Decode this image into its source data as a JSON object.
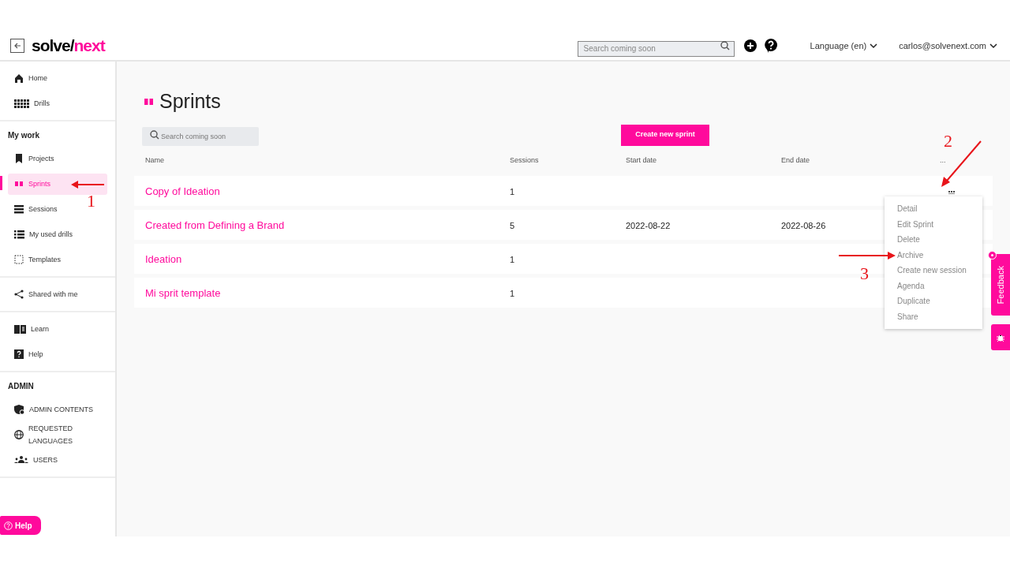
{
  "header": {
    "logo": {
      "text": "solve/",
      "accent": "next"
    },
    "search": {
      "placeholder": "Search coming soon"
    },
    "language": "Language (en)",
    "user": "carlos@solvenext.com"
  },
  "sidebar": {
    "sections": [
      {
        "items": [
          {
            "label": "Home",
            "selected": false
          },
          {
            "label": "Drills",
            "selected": false
          }
        ]
      },
      {
        "heading": "My work",
        "items": [
          {
            "label": "Projects",
            "selected": false
          },
          {
            "label": "Sprints",
            "selected": true
          },
          {
            "label": "Sessions",
            "selected": false
          },
          {
            "label": "My used drills",
            "selected": false
          },
          {
            "label": "Templates",
            "selected": false
          }
        ]
      },
      {
        "items": [
          {
            "label": "Shared with me",
            "selected": false
          }
        ]
      },
      {
        "items": [
          {
            "label": "Learn",
            "selected": false
          },
          {
            "label": "Help",
            "selected": false
          }
        ]
      },
      {
        "heading": "ADMIN",
        "items": [
          {
            "label": "ADMIN CONTENTS",
            "selected": false
          },
          {
            "label": "REQUESTED LANGUAGES",
            "selected": false
          },
          {
            "label": "USERS",
            "selected": false
          }
        ]
      }
    ],
    "help_button": "Help"
  },
  "page": {
    "title": "Sprints",
    "search": {
      "placeholder": "Search coming soon"
    },
    "create_button": "Create new sprint"
  },
  "table": {
    "columns": [
      "Name",
      "Sessions",
      "Start date",
      "End date",
      "..."
    ],
    "rows": [
      {
        "name": "Copy of Ideation",
        "sessions": "1",
        "menu_open": true
      },
      {
        "name": "Created from Defining a Brand",
        "sessions": "5",
        "start_date": "2022-08-22",
        "end_date": "2022-08-26",
        "menu_open": false
      },
      {
        "name": "Ideation",
        "sessions": "1",
        "menu_open": false
      },
      {
        "name": "Mi sprit template",
        "sessions": "1",
        "menu_open": false
      }
    ]
  },
  "row_menu": {
    "items": [
      "Detail",
      "Edit Sprint",
      "Delete",
      "Archive",
      "Create new session",
      "Agenda",
      "Duplicate",
      "Share"
    ]
  },
  "feedback_tab": "Feedback",
  "annotations": [
    "1",
    "2",
    "3"
  ]
}
